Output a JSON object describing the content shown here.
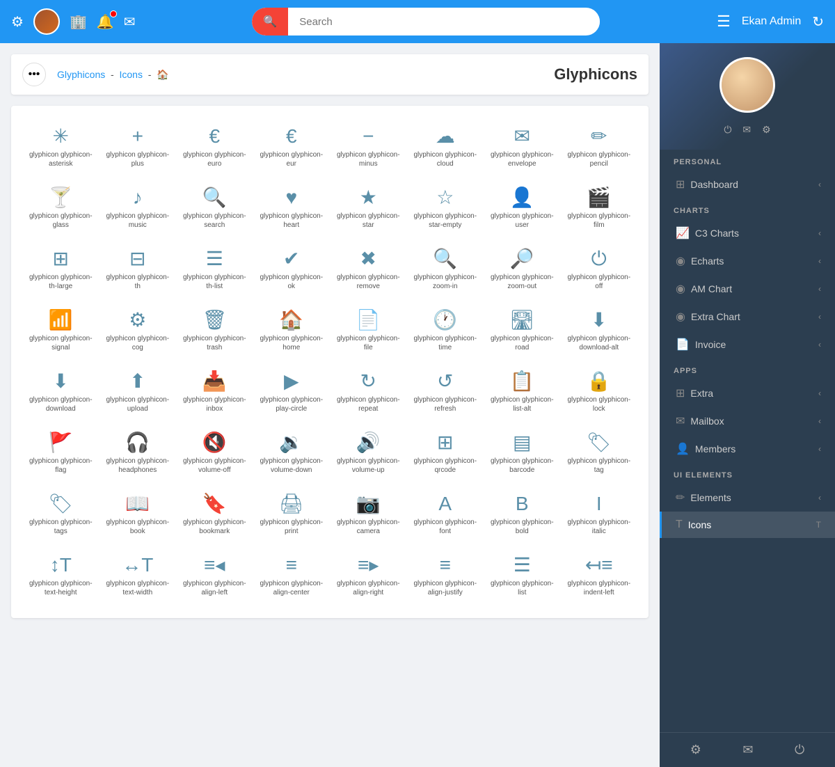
{
  "topnav": {
    "search_placeholder": "Search",
    "admin_name": "Ekan Admin"
  },
  "breadcrumb": {
    "items": [
      "Glyphicons",
      "Icons"
    ],
    "home": "🏠",
    "page_title": "Glyphicons"
  },
  "icons": [
    {
      "symbol": "✳",
      "label": "glyphicon glyphicon-asterisk"
    },
    {
      "symbol": "+",
      "label": "glyphicon glyphicon-plus"
    },
    {
      "symbol": "€",
      "label": "glyphicon glyphicon-euro"
    },
    {
      "symbol": "€",
      "label": "glyphicon glyphicon-eur"
    },
    {
      "symbol": "−",
      "label": "glyphicon glyphicon-minus"
    },
    {
      "symbol": "☁",
      "label": "glyphicon glyphicon-cloud"
    },
    {
      "symbol": "✉",
      "label": "glyphicon glyphicon-envelope"
    },
    {
      "symbol": "✏",
      "label": "glyphicon glyphicon-pencil"
    },
    {
      "symbol": "🍸",
      "label": "glyphicon glyphicon-glass"
    },
    {
      "symbol": "♪",
      "label": "glyphicon glyphicon-music"
    },
    {
      "symbol": "🔍",
      "label": "glyphicon glyphicon-search"
    },
    {
      "symbol": "♥",
      "label": "glyphicon glyphicon-heart"
    },
    {
      "symbol": "★",
      "label": "glyphicon glyphicon-star"
    },
    {
      "symbol": "☆",
      "label": "glyphicon glyphicon-star-empty"
    },
    {
      "symbol": "👤",
      "label": "glyphicon glyphicon-user"
    },
    {
      "symbol": "🎬",
      "label": "glyphicon glyphicon-film"
    },
    {
      "symbol": "⊞",
      "label": "glyphicon glyphicon-th-large"
    },
    {
      "symbol": "⊟",
      "label": "glyphicon glyphicon-th"
    },
    {
      "symbol": "☰",
      "label": "glyphicon glyphicon-th-list"
    },
    {
      "symbol": "✔",
      "label": "glyphicon glyphicon-ok"
    },
    {
      "symbol": "✖",
      "label": "glyphicon glyphicon-remove"
    },
    {
      "symbol": "🔍",
      "label": "glyphicon glyphicon-zoom-in"
    },
    {
      "symbol": "🔎",
      "label": "glyphicon glyphicon-zoom-out"
    },
    {
      "symbol": "⏻",
      "label": "glyphicon glyphicon-off"
    },
    {
      "symbol": "📶",
      "label": "glyphicon glyphicon-signal"
    },
    {
      "symbol": "⚙",
      "label": "glyphicon glyphicon-cog"
    },
    {
      "symbol": "🗑",
      "label": "glyphicon glyphicon-trash"
    },
    {
      "symbol": "🏠",
      "label": "glyphicon glyphicon-home"
    },
    {
      "symbol": "📄",
      "label": "glyphicon glyphicon-file"
    },
    {
      "symbol": "🕐",
      "label": "glyphicon glyphicon-time"
    },
    {
      "symbol": "🛣",
      "label": "glyphicon glyphicon-road"
    },
    {
      "symbol": "⬇",
      "label": "glyphicon glyphicon-download-alt"
    },
    {
      "symbol": "⬇",
      "label": "glyphicon glyphicon-download"
    },
    {
      "symbol": "⬆",
      "label": "glyphicon glyphicon-upload"
    },
    {
      "symbol": "📥",
      "label": "glyphicon glyphicon-inbox"
    },
    {
      "symbol": "▶",
      "label": "glyphicon glyphicon-play-circle"
    },
    {
      "symbol": "↻",
      "label": "glyphicon glyphicon-repeat"
    },
    {
      "symbol": "↺",
      "label": "glyphicon glyphicon-refresh"
    },
    {
      "symbol": "📋",
      "label": "glyphicon glyphicon-list-alt"
    },
    {
      "symbol": "🔒",
      "label": "glyphicon glyphicon-lock"
    },
    {
      "symbol": "🚩",
      "label": "glyphicon glyphicon-flag"
    },
    {
      "symbol": "🎧",
      "label": "glyphicon glyphicon-headphones"
    },
    {
      "symbol": "🔇",
      "label": "glyphicon glyphicon-volume-off"
    },
    {
      "symbol": "🔉",
      "label": "glyphicon glyphicon-volume-down"
    },
    {
      "symbol": "🔊",
      "label": "glyphicon glyphicon-volume-up"
    },
    {
      "symbol": "⊞",
      "label": "glyphicon glyphicon-qrcode"
    },
    {
      "symbol": "▤",
      "label": "glyphicon glyphicon-barcode"
    },
    {
      "symbol": "🏷",
      "label": "glyphicon glyphicon-tag"
    },
    {
      "symbol": "🏷",
      "label": "glyphicon glyphicon-tags"
    },
    {
      "symbol": "📖",
      "label": "glyphicon glyphicon-book"
    },
    {
      "symbol": "🔖",
      "label": "glyphicon glyphicon-bookmark"
    },
    {
      "symbol": "🖨",
      "label": "glyphicon glyphicon-print"
    },
    {
      "symbol": "📷",
      "label": "glyphicon glyphicon-camera"
    },
    {
      "symbol": "A",
      "label": "glyphicon glyphicon-font"
    },
    {
      "symbol": "B",
      "label": "glyphicon glyphicon-bold"
    },
    {
      "symbol": "I",
      "label": "glyphicon glyphicon-italic"
    },
    {
      "symbol": "↕T",
      "label": "glyphicon glyphicon-text-height"
    },
    {
      "symbol": "↔T",
      "label": "glyphicon glyphicon-text-width"
    },
    {
      "symbol": "≡◂",
      "label": "glyphicon glyphicon-align-left"
    },
    {
      "symbol": "≡",
      "label": "glyphicon glyphicon-align-center"
    },
    {
      "symbol": "≡▸",
      "label": "glyphicon glyphicon-align-right"
    },
    {
      "symbol": "≡",
      "label": "glyphicon glyphicon-align-justify"
    },
    {
      "symbol": "☰",
      "label": "glyphicon glyphicon-list"
    },
    {
      "symbol": "↤≡",
      "label": "glyphicon glyphicon-indent-left"
    }
  ],
  "sidebar": {
    "sections": {
      "personal": "PERSONAL",
      "charts": "CHARTS",
      "apps": "APPS",
      "ui_elements": "UI ELEMENTS"
    },
    "personal_items": [
      {
        "label": "Dashboard",
        "icon": "⊞",
        "arrow": true
      }
    ],
    "chart_items": [
      {
        "label": "C3 Charts",
        "icon": "📈",
        "arrow": true
      },
      {
        "label": "Echarts",
        "icon": "◉",
        "arrow": true
      },
      {
        "label": "AM Chart",
        "icon": "◉",
        "arrow": true
      },
      {
        "label": "Extra Chart",
        "icon": "◉",
        "arrow": true
      }
    ],
    "app_items": [
      {
        "label": "Invoice",
        "icon": "📄",
        "arrow": true
      },
      {
        "label": "Extra",
        "icon": "⊞",
        "arrow": true
      },
      {
        "label": "Mailbox",
        "icon": "✉",
        "arrow": true
      },
      {
        "label": "Members",
        "icon": "👤",
        "arrow": true
      }
    ],
    "ui_items": [
      {
        "label": "Elements",
        "icon": "✏",
        "arrow": true
      },
      {
        "label": "Icons",
        "icon": "T",
        "active": true
      }
    ],
    "bottom_icons": [
      "⚙",
      "✉",
      "⏻"
    ]
  }
}
